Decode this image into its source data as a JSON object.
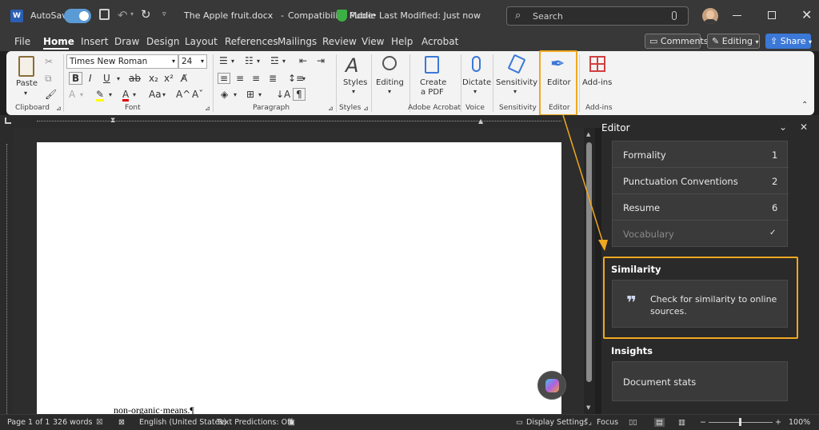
{
  "title_bar": {
    "autosave_label": "AutoSave",
    "document_name": "The Apple fruit.docx",
    "separator": "-",
    "mode": "Compatibility Mode",
    "sensitivity": "Public",
    "bullet": "•",
    "last_modified": "Last Modified: Just now",
    "search_placeholder": "Search"
  },
  "menu": {
    "items": [
      "File",
      "Home",
      "Insert",
      "Draw",
      "Design",
      "Layout",
      "References",
      "Mailings",
      "Review",
      "View",
      "Help",
      "Acrobat"
    ],
    "active": "Home",
    "comments_label": "Comments",
    "editing_label": "Editing",
    "share_label": "Share"
  },
  "ribbon": {
    "font_name": "Times New Roman",
    "font_size": "24",
    "paste_label": "Paste",
    "styles_label": "Styles",
    "editing_label": "Editing",
    "create_pdf_label_1": "Create",
    "create_pdf_label_2": "a PDF",
    "dictate_label": "Dictate",
    "sensitivity_label": "Sensitivity",
    "editor_label": "Editor",
    "addins_label": "Add-ins",
    "group_labels": {
      "clipboard": "Clipboard",
      "font": "Font",
      "paragraph": "Paragraph",
      "styles": "Styles",
      "acrobat": "Adobe Acrobat",
      "voice": "Voice",
      "sensitivity": "Sensitivity",
      "editor": "Editor",
      "addins": "Add-ins"
    }
  },
  "document": {
    "visible_text": "non-organic·means.¶"
  },
  "editor_pane": {
    "title": "Editor",
    "refinements": [
      {
        "label": "Formality",
        "value": "1"
      },
      {
        "label": "Punctuation Conventions",
        "value": "2"
      },
      {
        "label": "Resume",
        "value": "6"
      },
      {
        "label": "Vocabulary",
        "value": "✓"
      }
    ],
    "similarity_heading": "Similarity",
    "similarity_text_1": "Check for similarity to online",
    "similarity_text_2": "sources.",
    "insights_heading": "Insights",
    "document_stats": "Document stats"
  },
  "status_bar": {
    "page": "Page 1 of 1",
    "words": "326 words",
    "language": "English (United States)",
    "predictions": "Text Predictions: Off",
    "display_settings": "Display Settings",
    "focus": "Focus",
    "zoom": "100%"
  },
  "colors": {
    "accent": "#f0a820",
    "toggle": "#5b9bd5",
    "share": "#3b78d8",
    "word_blue": "#2b5fb4"
  }
}
